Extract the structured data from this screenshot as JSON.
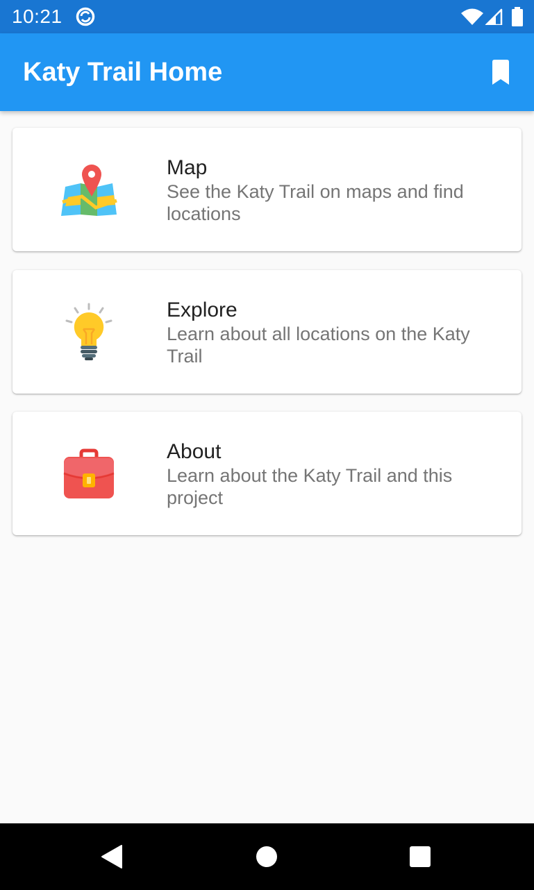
{
  "status_bar": {
    "time": "10:21",
    "icons": [
      "sync-icon",
      "wifi-icon",
      "signal-icon",
      "battery-icon"
    ]
  },
  "app_bar": {
    "title": "Katy Trail Home",
    "action_icon": "bookmark-icon",
    "color": "#2196f3"
  },
  "cards": [
    {
      "title": "Map",
      "subtitle": "See the Katy Trail on maps and find locations",
      "icon": "map-icon"
    },
    {
      "title": "Explore",
      "subtitle": "Learn about all locations on the Katy Trail",
      "icon": "lightbulb-icon"
    },
    {
      "title": "About",
      "subtitle": "Learn about the Katy Trail and this project",
      "icon": "briefcase-icon"
    }
  ],
  "nav_bar": {
    "icons": [
      "back-icon",
      "home-icon",
      "recents-icon"
    ]
  }
}
